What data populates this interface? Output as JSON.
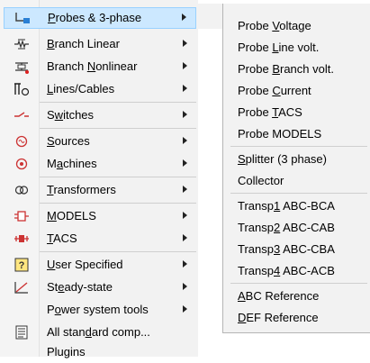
{
  "main_menu": {
    "items": [
      {
        "pre": "",
        "key": "P",
        "post": "robes & 3-phase",
        "arrow": true,
        "icon": "probe-icon"
      },
      {
        "pre": "",
        "key": "B",
        "post": "ranch Linear",
        "arrow": true,
        "icon": "branch-linear-icon"
      },
      {
        "pre": "Branch ",
        "key": "N",
        "post": "onlinear",
        "arrow": true,
        "icon": "branch-nonlinear-icon"
      },
      {
        "pre": "",
        "key": "L",
        "post": "ines/Cables",
        "arrow": true,
        "icon": "lines-cables-icon"
      },
      {
        "pre": "S",
        "key": "w",
        "post": "itches",
        "arrow": true,
        "icon": "switch-icon"
      },
      {
        "pre": "",
        "key": "S",
        "post": "ources",
        "arrow": true,
        "icon": "source-icon"
      },
      {
        "pre": "M",
        "key": "a",
        "post": "chines",
        "arrow": true,
        "icon": "machine-icon"
      },
      {
        "pre": "",
        "key": "T",
        "post": "ransformers",
        "arrow": true,
        "icon": "transformer-icon"
      },
      {
        "pre": "",
        "key": "M",
        "post": "ODELS",
        "arrow": true,
        "icon": "models-icon"
      },
      {
        "pre": "",
        "key": "T",
        "post": "ACS",
        "arrow": true,
        "icon": "tacs-icon"
      },
      {
        "pre": "",
        "key": "U",
        "post": "ser Specified",
        "arrow": true,
        "icon": "user-specified-icon"
      },
      {
        "pre": "St",
        "key": "e",
        "post": "ady-state",
        "arrow": true,
        "icon": "steady-state-icon"
      },
      {
        "pre": "P",
        "key": "o",
        "post": "wer system tools",
        "arrow": true,
        "icon": ""
      },
      {
        "pre": "All stan",
        "key": "d",
        "post": "ard comp...",
        "arrow": false,
        "icon": "all-components-icon"
      },
      {
        "pre": "Plugins",
        "key": "",
        "post": "",
        "arrow": false,
        "icon": ""
      }
    ]
  },
  "sub_menu": {
    "items": [
      {
        "pre": "Probe ",
        "key": "V",
        "post": "oltage"
      },
      {
        "pre": "Probe ",
        "key": "L",
        "post": "ine volt."
      },
      {
        "pre": "Probe ",
        "key": "B",
        "post": "ranch volt."
      },
      {
        "pre": "Probe ",
        "key": "C",
        "post": "urrent"
      },
      {
        "pre": "Probe ",
        "key": "T",
        "post": "ACS"
      },
      {
        "pre": "Probe MODELS",
        "key": "",
        "post": ""
      },
      {
        "pre": "",
        "key": "S",
        "post": "plitter (3 phase)"
      },
      {
        "pre": "Collector",
        "key": "",
        "post": ""
      },
      {
        "pre": "Transp",
        "key": "1",
        "post": " ABC-BCA"
      },
      {
        "pre": "Transp",
        "key": "2",
        "post": " ABC-CAB"
      },
      {
        "pre": "Transp",
        "key": "3",
        "post": " ABC-CBA"
      },
      {
        "pre": "Transp",
        "key": "4",
        "post": " ABC-ACB"
      },
      {
        "pre": "",
        "key": "A",
        "post": "BC Reference"
      },
      {
        "pre": "",
        "key": "D",
        "post": "EF Reference"
      }
    ]
  },
  "colors": {
    "selected_bg": "#cce8ff",
    "selected_border": "#99d1ff",
    "menu_bg": "#f2f2f2"
  }
}
